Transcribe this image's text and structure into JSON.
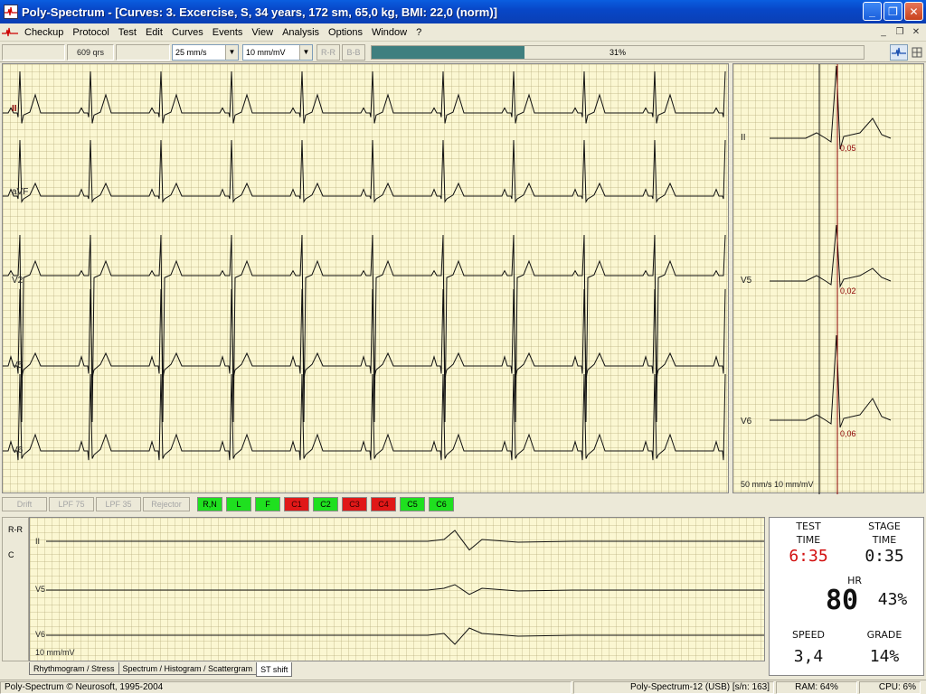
{
  "window": {
    "title": "Poly-Spectrum - [Curves: 3. Excercise, S, 34 years, 172 sm, 65,0 kg, BMI: 22,0 (norm)]",
    "minimize": "_",
    "maximize": "❐",
    "close": "✕"
  },
  "menu": {
    "items": [
      "Checkup",
      "Protocol",
      "Test",
      "Edit",
      "Curves",
      "Events",
      "View",
      "Analysis",
      "Options",
      "Window",
      "?"
    ],
    "mdi_minimize": "_",
    "mdi_restore": "❐",
    "mdi_close": "✕"
  },
  "toolbar": {
    "qrs_count": "609 qrs",
    "speed": "25 mm/s",
    "gain": "10 mm/mV",
    "rr_button": "R-R",
    "bb_button": "B-B",
    "progress_percent": 31,
    "progress_text": "31%"
  },
  "ecg_main": {
    "leads": [
      "II",
      "aVF",
      "V2",
      "V5",
      "V6"
    ],
    "highlight_lead": "II"
  },
  "ecg_side": {
    "leads": [
      "II",
      "V5",
      "V6"
    ],
    "st_values": [
      "0,05",
      "0,02",
      "0,06"
    ],
    "scale_note": "50 mm/s 10 mm/mV"
  },
  "filters": {
    "buttons": [
      "Drift",
      "LPF 75",
      "LPF 35",
      "Rejector"
    ],
    "lead_buttons": [
      {
        "label": "R,N",
        "color": "green"
      },
      {
        "label": "L",
        "color": "green"
      },
      {
        "label": "F",
        "color": "green"
      },
      {
        "label": "C1",
        "color": "red"
      },
      {
        "label": "C2",
        "color": "green"
      },
      {
        "label": "C3",
        "color": "red"
      },
      {
        "label": "C4",
        "color": "red"
      },
      {
        "label": "C5",
        "color": "green"
      },
      {
        "label": "C6",
        "color": "green"
      }
    ]
  },
  "st_panel": {
    "side_labels": [
      "R-R",
      "C"
    ],
    "leads": [
      "II",
      "V5",
      "V6"
    ],
    "scale": "10 mm/mV"
  },
  "stats": {
    "test_time_label": "TEST\nTIME",
    "test_time_caption_1": "TEST",
    "test_time_caption_2": "TIME",
    "test_time": "6:35",
    "stage_time_caption_1": "STAGE",
    "stage_time_caption_2": "TIME",
    "stage_time": "0:35",
    "hr_caption": "HR",
    "hr": "80",
    "hr_percent": "43%",
    "speed_caption": "SPEED",
    "speed": "3,4",
    "grade_caption": "GRADE",
    "grade": "14%"
  },
  "tabs": [
    "Rhythmogram / Stress",
    "Spectrum / Histogram / Scattergram",
    "ST shift"
  ],
  "status": {
    "copyright": "Poly-Spectrum © Neurosoft, 1995-2004",
    "device": "Poly-Spectrum-12 (USB) [s/n: 163]",
    "ram": "RAM: 64%",
    "cpu": "CPU: 6%"
  },
  "colors": {
    "title_bar": "#0a4fd0",
    "progress_fill": "#3f7f7f",
    "grid_bg": "#fbf7d2",
    "test_time_red": "#d21010"
  }
}
